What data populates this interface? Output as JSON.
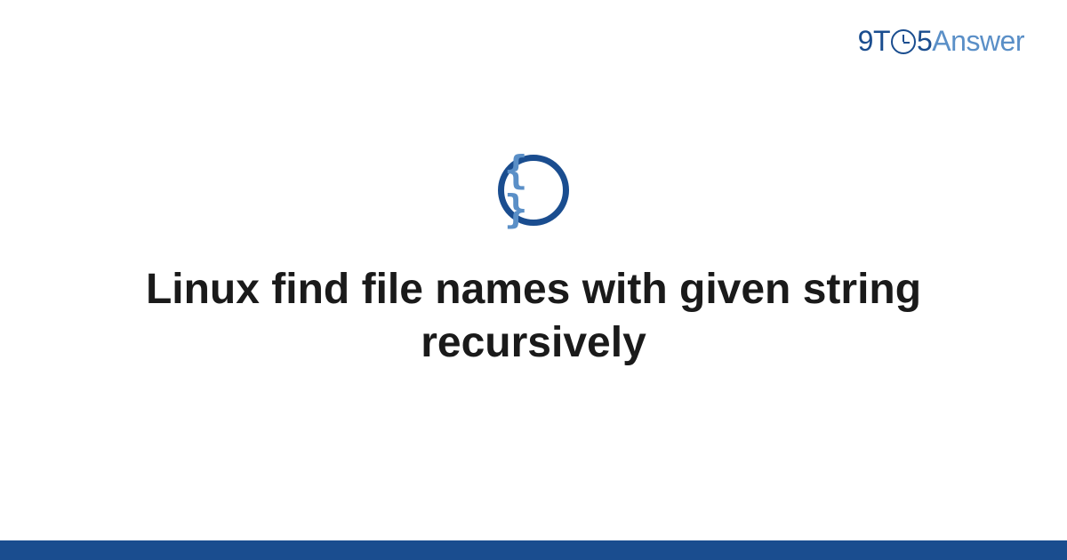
{
  "logo": {
    "part1": "9T",
    "part2": "5",
    "part3": "Answer"
  },
  "icon": {
    "name": "code-braces-icon",
    "symbol": "{ }"
  },
  "title": "Linux find file names with given string recursively",
  "colors": {
    "primary": "#1a4d8f",
    "secondary": "#5a8fc7",
    "text": "#1a1a1a"
  }
}
